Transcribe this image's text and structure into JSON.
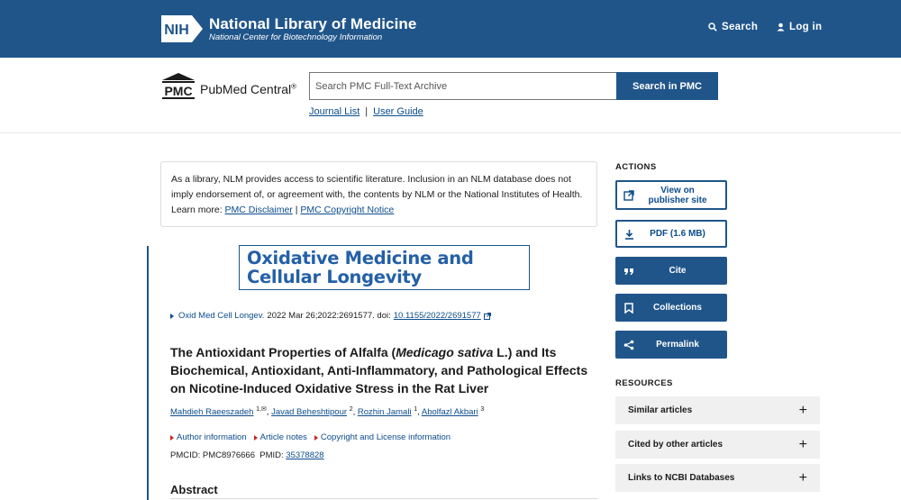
{
  "header": {
    "logo_badge": "NIH",
    "title": "National Library of Medicine",
    "subtitle": "National Center for Biotechnology Information",
    "search_label": "Search",
    "login_label": "Log in"
  },
  "pmc": {
    "logo_mark": "PMC",
    "name": "PubMed Central",
    "registered": "®",
    "search_placeholder": "Search PMC Full-Text Archive",
    "search_button": "Search in PMC",
    "journal_list": "Journal List",
    "separator": "|",
    "user_guide": "User Guide"
  },
  "disclaimer": {
    "text": "As a library, NLM provides access to scientific literature. Inclusion in an NLM database does not imply endorsement of, or agreement with, the contents by NLM or the National Institutes of Health.",
    "learn_more": "Learn more:",
    "link1": "PMC Disclaimer",
    "divider": "|",
    "link2": "PMC Copyright Notice"
  },
  "article": {
    "journal_banner": "Oxidative Medicine and Cellular Longevity",
    "journal_abbrev": "Oxid Med Cell Longev.",
    "citation_rest": "2022 Mar 26;2022:2691577. doi:",
    "doi": "10.1155/2022/2691577",
    "title_part1": "The Antioxidant Properties of Alfalfa (",
    "title_italic": "Medicago sativa",
    "title_part2": " L.) and Its Biochemical, Antioxidant, Anti-Inflammatory, and Pathological Effects on Nicotine-Induced Oxidative Stress in the Rat Liver",
    "authors": [
      {
        "name": "Mahdieh Raeeszadeh",
        "sup": "1,✉"
      },
      {
        "name": "Javad Beheshtipour",
        "sup": "2"
      },
      {
        "name": "Rozhin Jamali",
        "sup": "1"
      },
      {
        "name": "Abolfazl Akbari",
        "sup": "3"
      }
    ],
    "author_info": "Author information",
    "article_notes": "Article notes",
    "copyright_info": "Copyright and License information",
    "pmcid_label": "PMCID: PMC8976666",
    "pmid_label": "PMID:",
    "pmid": "35378828",
    "abstract_heading": "Abstract"
  },
  "sidebar": {
    "actions_heading": "ACTIONS",
    "actions": [
      {
        "label": "View on publisher site",
        "icon": "external-link-icon"
      },
      {
        "label": "PDF (1.6 MB)",
        "icon": "download-icon"
      },
      {
        "label": "Cite",
        "icon": "quote-icon"
      },
      {
        "label": "Collections",
        "icon": "bookmark-icon"
      },
      {
        "label": "Permalink",
        "icon": "share-icon"
      }
    ],
    "resources_heading": "RESOURCES",
    "resources": [
      {
        "label": "Similar articles"
      },
      {
        "label": "Cited by other articles"
      },
      {
        "label": "Links to NCBI Databases"
      }
    ],
    "expand_symbol": "+"
  },
  "colors": {
    "brand": "#20558a",
    "link": "#0b4c8c",
    "accent_red": "#d42020"
  }
}
